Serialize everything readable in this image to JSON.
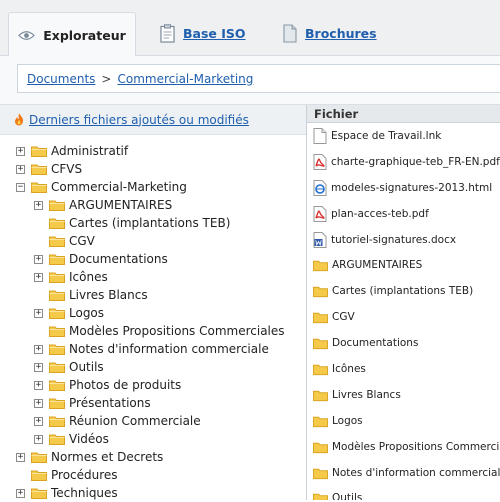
{
  "tabs": [
    {
      "label": "Explorateur",
      "icon": "eye-icon",
      "active": true
    },
    {
      "label": "Base ISO",
      "icon": "clipboard-icon",
      "active": false
    },
    {
      "label": "Brochures",
      "icon": "document-icon",
      "active": false
    }
  ],
  "breadcrumb": {
    "items": [
      "Documents",
      "Commercial-Marketing"
    ],
    "separator": ">"
  },
  "recent_link": {
    "label": "Derniers fichiers ajoutés ou modifiés",
    "icon": "fire-icon"
  },
  "tree": [
    {
      "label": "Administratif",
      "level": 0,
      "expander": "+"
    },
    {
      "label": "CFVS",
      "level": 0,
      "expander": "+"
    },
    {
      "label": "Commercial-Marketing",
      "level": 0,
      "expander": "−",
      "open": true
    },
    {
      "label": "ARGUMENTAIRES",
      "level": 1,
      "expander": "+"
    },
    {
      "label": "Cartes (implantations TEB)",
      "level": 1,
      "expander": ""
    },
    {
      "label": "CGV",
      "level": 1,
      "expander": ""
    },
    {
      "label": "Documentations",
      "level": 1,
      "expander": "+"
    },
    {
      "label": "Icônes",
      "level": 1,
      "expander": "+"
    },
    {
      "label": "Livres Blancs",
      "level": 1,
      "expander": ""
    },
    {
      "label": "Logos",
      "level": 1,
      "expander": "+"
    },
    {
      "label": "Modèles Propositions Commerciales",
      "level": 1,
      "expander": ""
    },
    {
      "label": "Notes d'information commerciale",
      "level": 1,
      "expander": "+"
    },
    {
      "label": "Outils",
      "level": 1,
      "expander": "+"
    },
    {
      "label": "Photos de produits",
      "level": 1,
      "expander": "+"
    },
    {
      "label": "Présentations",
      "level": 1,
      "expander": "+"
    },
    {
      "label": "Réunion Commerciale",
      "level": 1,
      "expander": "+"
    },
    {
      "label": "Vidéos",
      "level": 1,
      "expander": "+"
    },
    {
      "label": "Normes et Decrets",
      "level": 0,
      "expander": "+"
    },
    {
      "label": "Procédures",
      "level": 0,
      "expander": ""
    },
    {
      "label": "Techniques",
      "level": 0,
      "expander": "+"
    }
  ],
  "filelist": {
    "column_header": "Fichier",
    "items": [
      {
        "name": "Espace de Travail.lnk",
        "icon": "shortcut-icon"
      },
      {
        "name": "charte-graphique-teb_FR-EN.pdf",
        "icon": "pdf-icon"
      },
      {
        "name": "modeles-signatures-2013.html",
        "icon": "html-icon"
      },
      {
        "name": "plan-acces-teb.pdf",
        "icon": "pdf-icon"
      },
      {
        "name": "tutoriel-signatures.docx",
        "icon": "word-icon"
      },
      {
        "name": "ARGUMENTAIRES",
        "icon": "folder-icon"
      },
      {
        "name": "Cartes (implantations TEB)",
        "icon": "folder-icon"
      },
      {
        "name": "CGV",
        "icon": "folder-icon"
      },
      {
        "name": "Documentations",
        "icon": "folder-icon"
      },
      {
        "name": "Icônes",
        "icon": "folder-icon"
      },
      {
        "name": "Livres Blancs",
        "icon": "folder-icon"
      },
      {
        "name": "Logos",
        "icon": "folder-icon"
      },
      {
        "name": "Modèles Propositions Commerciales",
        "icon": "folder-icon"
      },
      {
        "name": "Notes d'information commerciale",
        "icon": "folder-icon"
      },
      {
        "name": "Outils",
        "icon": "folder-icon"
      }
    ]
  },
  "colors": {
    "link": "#1f5fae",
    "folder": "#f5c94a",
    "folder_edge": "#d9a521",
    "pdf": "#d62b2b"
  }
}
